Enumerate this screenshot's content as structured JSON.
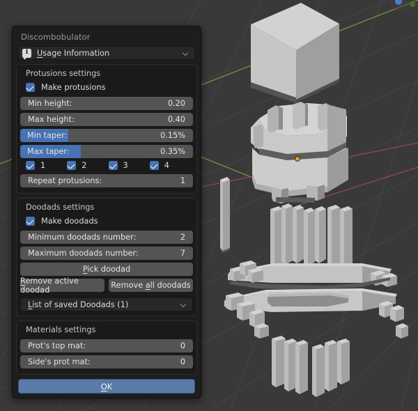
{
  "app": {
    "name": "blender-3d-viewport"
  },
  "dialog": {
    "title": "Discombobulator",
    "usage": {
      "label": "Usage Information",
      "accel": "U",
      "icon": "info-icon",
      "chevron": "chevron-down-icon"
    },
    "protrusions": {
      "title": "Protusions settings",
      "make": {
        "label": "Make protusions",
        "checked": true
      },
      "fields": [
        {
          "label": "Min height:",
          "value": "0.20",
          "type": "number",
          "fill_pct": 0
        },
        {
          "label": "Max height:",
          "value": "0.40",
          "type": "number",
          "fill_pct": 0
        },
        {
          "label": "Min taper:",
          "value": "0.15%",
          "type": "slider",
          "fill_pct": 28
        },
        {
          "label": "Max taper:",
          "value": "0.35%",
          "type": "slider",
          "fill_pct": 35
        }
      ],
      "face_checks": [
        {
          "label": "1",
          "checked": true
        },
        {
          "label": "2",
          "checked": true
        },
        {
          "label": "3",
          "checked": true
        },
        {
          "label": "4",
          "checked": true
        }
      ],
      "repeat": {
        "label": "Repeat protusions:",
        "value": "1"
      }
    },
    "doodads": {
      "title": "Doodads settings",
      "make": {
        "label": "Make doodads",
        "checked": true
      },
      "fields": [
        {
          "label": "Minimum doodads number:",
          "value": "2"
        },
        {
          "label": "Maximum doodads number:",
          "value": "7"
        }
      ],
      "pick_button": {
        "label": "Pick doodad",
        "accel": "P"
      },
      "remove_active_button": {
        "label": "Remove active doodad",
        "accel": "R"
      },
      "remove_all_button": {
        "label": "Remove all doodads",
        "accel": "a"
      },
      "saved_list": {
        "label": "List of saved Doodads (1)",
        "accel": "L",
        "count": 1
      }
    },
    "materials": {
      "title": "Materials settings",
      "fields": [
        {
          "label": "Prot's top mat:",
          "value": "0"
        },
        {
          "label": "Side's prot mat:",
          "value": "0"
        }
      ]
    },
    "confirm": {
      "label": "OK",
      "accel": "O"
    }
  },
  "colors": {
    "panel_bg": "#1d1d1d",
    "subpanel_bg": "#1a1a1a",
    "widget_bg": "#545454",
    "accent_blue": "#4772b3",
    "ok_blue": "#5a7aa8",
    "viewport_bg": "#393939",
    "mesh_light": "#c9c9c9",
    "mesh_mid": "#a8a8a8",
    "mesh_dark": "#6e6e6e",
    "axis_x": "#a34657",
    "axis_y": "#7c9c3d",
    "origin_dot": "#e8a030"
  },
  "viewport": {
    "origin_marker": "object-origin-dot",
    "gizmo": "navigation-gizmo",
    "objects": [
      "cube-original",
      "cube-discombobulated",
      "doodad-plank",
      "complex-discombobulated-mesh"
    ]
  }
}
